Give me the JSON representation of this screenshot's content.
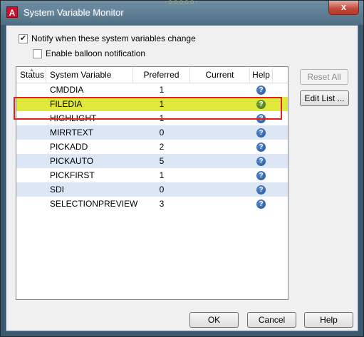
{
  "window": {
    "title": "System Variable Monitor",
    "app_icon_letter": "A",
    "close_glyph": "x",
    "title_glyphs": "·○○○○○·"
  },
  "options": {
    "notify": {
      "label": "Notify when these system variables change",
      "checked": true,
      "mark": "✔"
    },
    "balloon": {
      "label": "Enable balloon notification",
      "checked": false,
      "mark": ""
    }
  },
  "table": {
    "columns": [
      "Status",
      "System Variable",
      "Preferred",
      "Current",
      "Help"
    ],
    "sort_indicator": "▲",
    "help_glyph": "?",
    "rows": [
      {
        "name": "CMDDIA",
        "preferred": "1",
        "current": "",
        "help_icon_color": "#1f4f9a"
      },
      {
        "name": "FILEDIA",
        "preferred": "1",
        "current": "",
        "help_icon_color": "#3d6e12"
      },
      {
        "name": "HIGHLIGHT",
        "preferred": "1",
        "current": "",
        "help_icon_color": "#1f4f9a"
      },
      {
        "name": "MIRRTEXT",
        "preferred": "0",
        "current": "",
        "help_icon_color": "#1f4f9a"
      },
      {
        "name": "PICKADD",
        "preferred": "2",
        "current": "",
        "help_icon_color": "#1f4f9a"
      },
      {
        "name": "PICKAUTO",
        "preferred": "5",
        "current": "",
        "help_icon_color": "#1f4f9a"
      },
      {
        "name": "PICKFIRST",
        "preferred": "1",
        "current": "",
        "help_icon_color": "#1f4f9a"
      },
      {
        "name": "SDI",
        "preferred": "0",
        "current": "",
        "help_icon_color": "#1f4f9a"
      },
      {
        "name": "SELECTIONPREVIEW",
        "preferred": "3",
        "current": "",
        "help_icon_color": "#1f4f9a"
      }
    ],
    "selected_row": "FILEDIA",
    "selected_color": "#e0e83c",
    "annotation_color": "#e2211c"
  },
  "side_buttons": {
    "reset_all": "Reset All",
    "edit_list": "Edit List ..."
  },
  "footer_buttons": {
    "ok": "OK",
    "cancel": "Cancel",
    "help": "Help"
  }
}
